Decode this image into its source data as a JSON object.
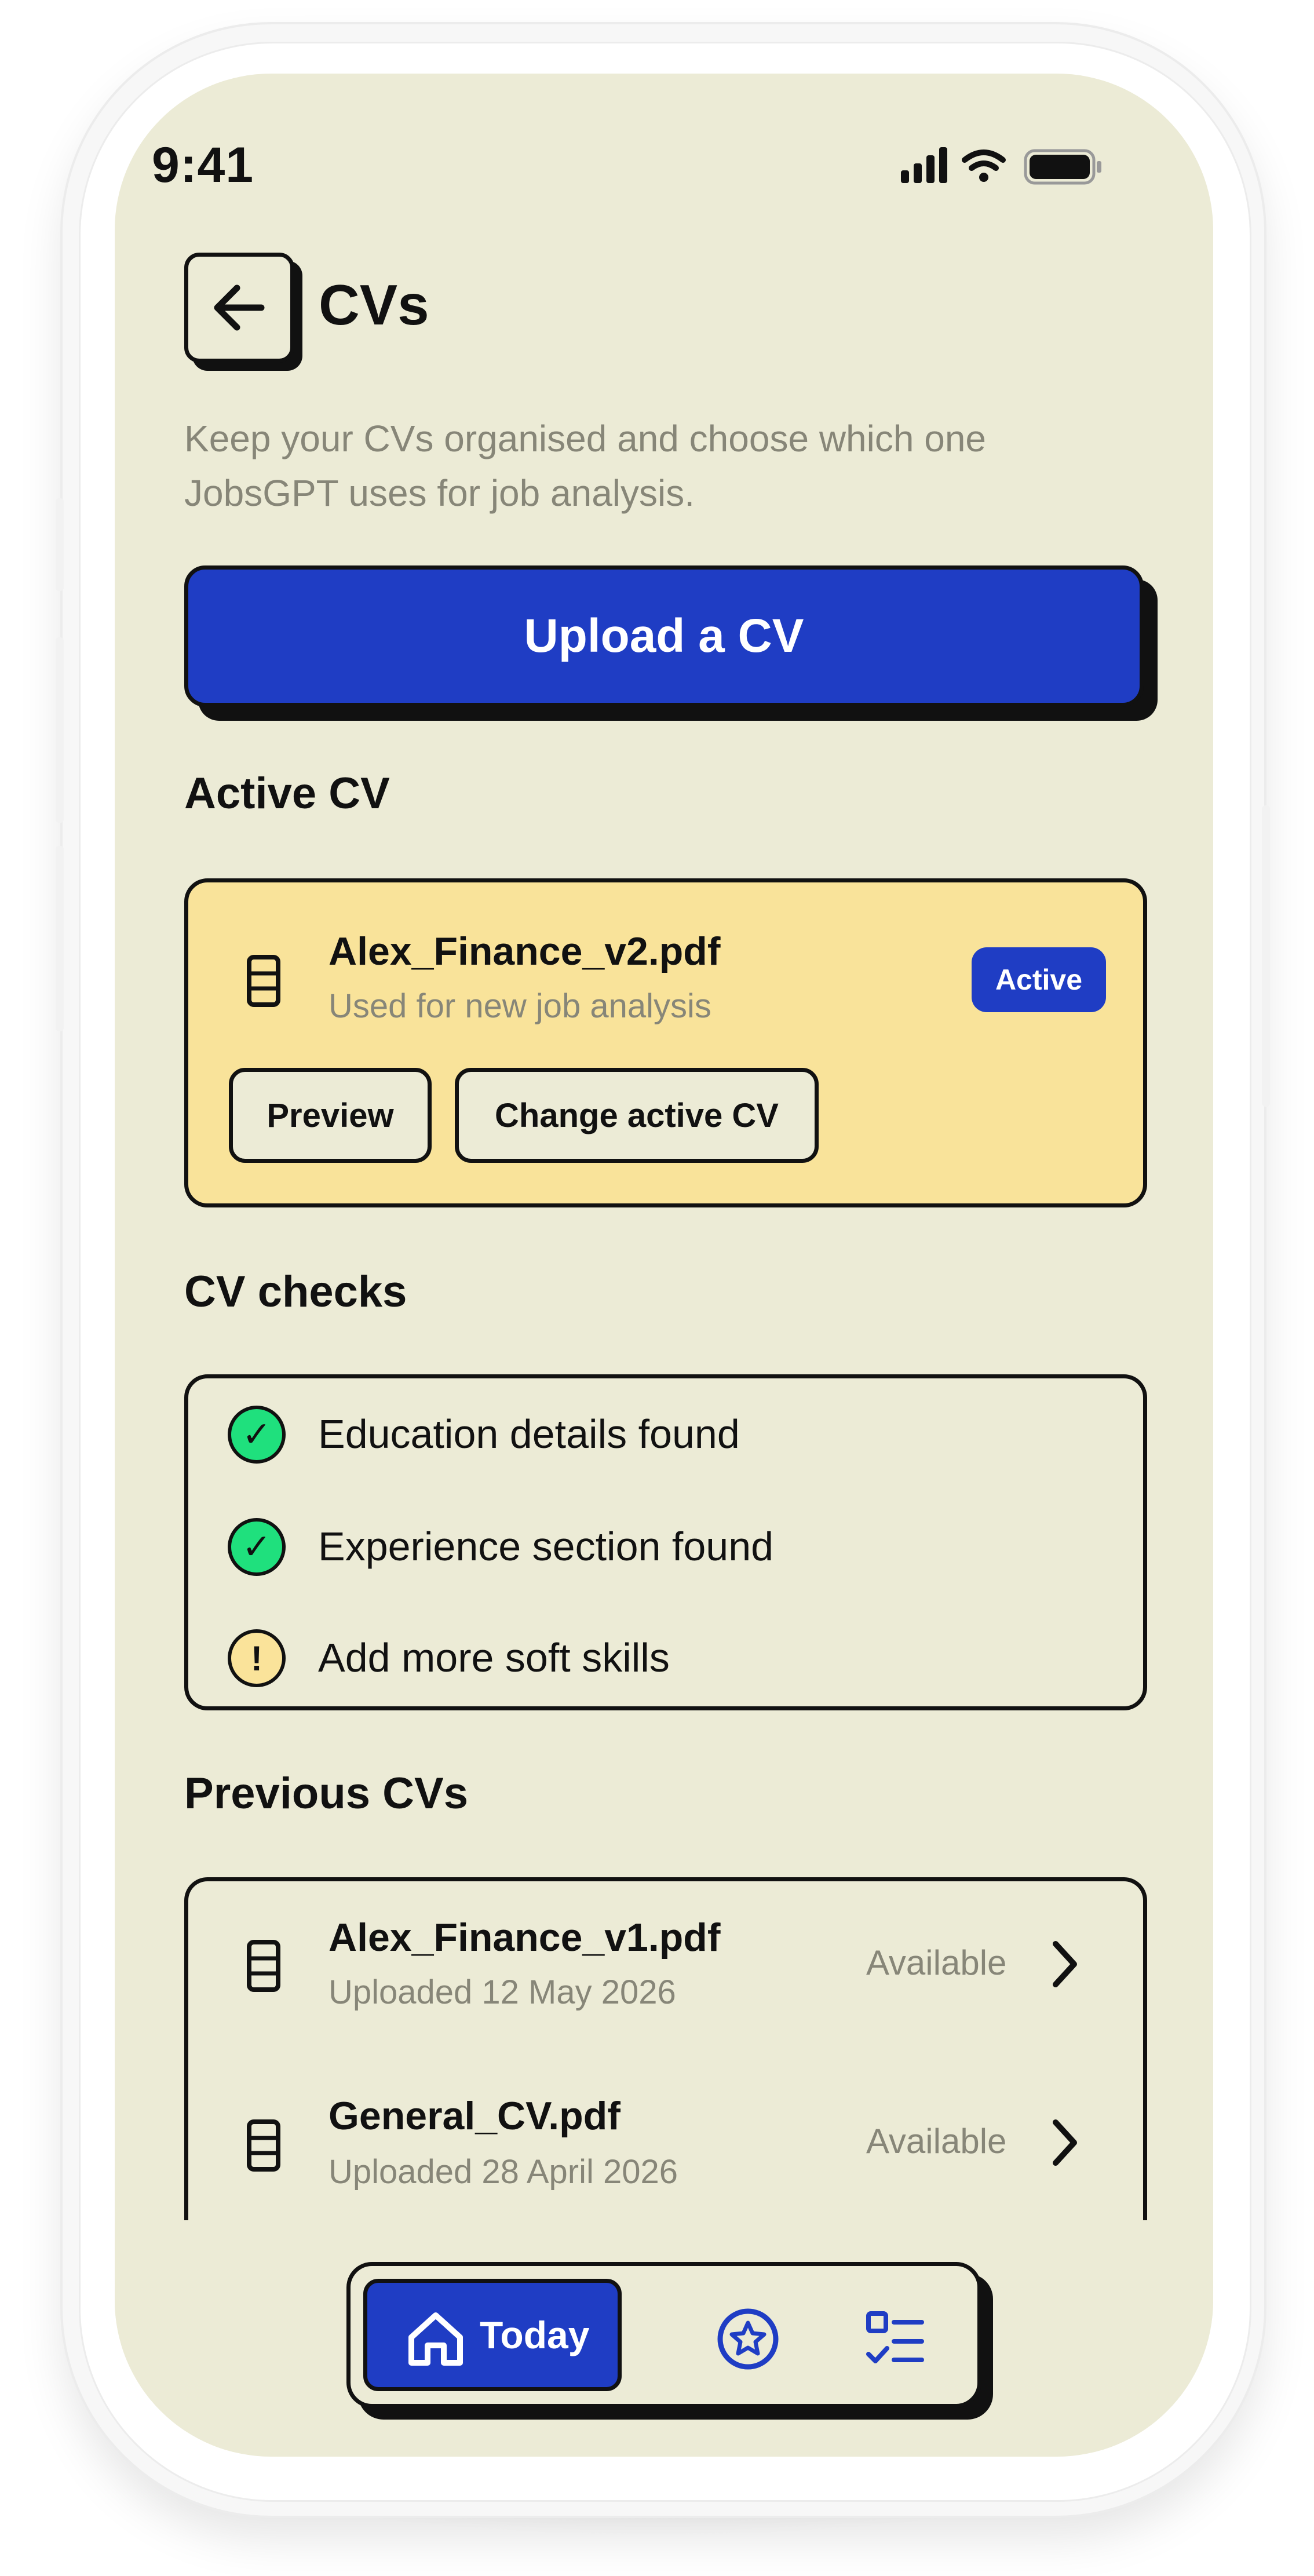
{
  "status_bar": {
    "time": "9:41"
  },
  "header": {
    "title": "CVs",
    "back_icon": "arrow-left-icon"
  },
  "subtitle": "Keep your CVs organised and choose which one JobsGPT uses for job analysis.",
  "upload_button": "Upload a CV",
  "active_section": {
    "title": "Active CV",
    "file_name": "Alex_Finance_v2.pdf",
    "meta": "Used for new job analysis",
    "badge": "Active",
    "preview_button": "Preview",
    "change_button": "Change active CV"
  },
  "checks_section": {
    "title": "CV checks",
    "items": [
      {
        "label": "Education details found",
        "status": "ok",
        "symbol": "✓"
      },
      {
        "label": "Experience section found",
        "status": "ok",
        "symbol": "✓"
      },
      {
        "label": "Add more soft skills",
        "status": "warning",
        "symbol": "!"
      }
    ]
  },
  "previous_section": {
    "title": "Previous CVs",
    "items": [
      {
        "file_name": "Alex_Finance_v1.pdf",
        "meta": "Uploaded 12 May 2026",
        "status": "Available"
      },
      {
        "file_name": "General_CV.pdf",
        "meta": "Uploaded 28 April 2026",
        "status": "Available"
      }
    ]
  },
  "bottom_nav": {
    "today_label": "Today",
    "icons": [
      "home-icon",
      "star-badge-icon",
      "checklist-icon"
    ]
  },
  "colors": {
    "background": "#ecebd6",
    "primary": "#1f3dc4",
    "active_card": "#f9e39a",
    "success": "#1fe07d",
    "warning": "#fae39a",
    "muted_text": "#878678"
  }
}
